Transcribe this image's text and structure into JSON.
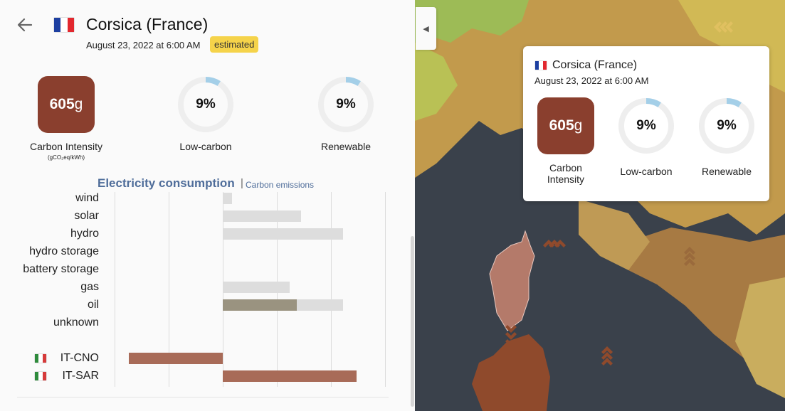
{
  "panel": {
    "zone_name": "Corsica (France)",
    "date": "August 23, 2022 at 6:00 AM",
    "badge": "estimated",
    "carbon_intensity": {
      "value": "605",
      "unit": "g",
      "label": "Carbon Intensity",
      "unit_label": "(gCO₂eq/kWh)"
    },
    "low_carbon": {
      "value": "9%",
      "label": "Low-carbon",
      "fraction": 0.09
    },
    "renewable": {
      "value": "9%",
      "label": "Renewable",
      "fraction": 0.09
    },
    "tabs": {
      "active": "Electricity consumption",
      "separator": "|",
      "other": "Carbon emissions"
    },
    "rows": [
      {
        "label": "wind"
      },
      {
        "label": "solar"
      },
      {
        "label": "hydro"
      },
      {
        "label": "hydro storage"
      },
      {
        "label": "battery storage"
      },
      {
        "label": "gas"
      },
      {
        "label": "oil"
      },
      {
        "label": "unknown"
      }
    ],
    "exchanges": [
      {
        "label": "IT-CNO"
      },
      {
        "label": "IT-SAR"
      }
    ]
  },
  "chart_data": {
    "type": "bar",
    "categories": [
      "wind",
      "solar",
      "hydro",
      "hydro storage",
      "battery storage",
      "gas",
      "oil",
      "unknown",
      "IT-CNO",
      "IT-SAR"
    ],
    "series": [
      {
        "values": [
          0.17,
          1.45,
          2.23,
          0,
          0,
          1.24,
          1.37,
          0,
          -1.74,
          2.48
        ]
      }
    ],
    "capacity_values": [
      0.17,
      1.45,
      2.23,
      0,
      0,
      1.24,
      2.23,
      0,
      null,
      null
    ],
    "xlim": [
      -2,
      3
    ],
    "grid": true
  },
  "tooltip": {
    "zone_name": "Corsica (France)",
    "date": "August 23, 2022 at 6:00 AM",
    "carbon_intensity": {
      "value": "605",
      "unit": "g",
      "label": "Carbon Intensity"
    },
    "low_carbon": {
      "value": "9%",
      "label": "Low-carbon",
      "fraction": 0.09
    },
    "renewable": {
      "value": "9%",
      "label": "Renewable",
      "fraction": 0.09
    }
  },
  "colors": {
    "carbon_box": "#8a3f2e",
    "ring_track": "#eeeeee",
    "ring_fill": "#a4cfe8",
    "accent_tab": "#4f6d9a",
    "badge": "#f5d34a",
    "oil_bar": "#9a9380",
    "capacity_bar": "#dddddd",
    "exchange_bar": "#a86b58"
  },
  "icons": {
    "back": "arrow-left-icon",
    "collapse": "chevron-left-icon",
    "flag_fr": "france-flag-icon",
    "flag_it": "italy-flag-icon",
    "exchange_arrow": "exchange-arrow-icon"
  }
}
